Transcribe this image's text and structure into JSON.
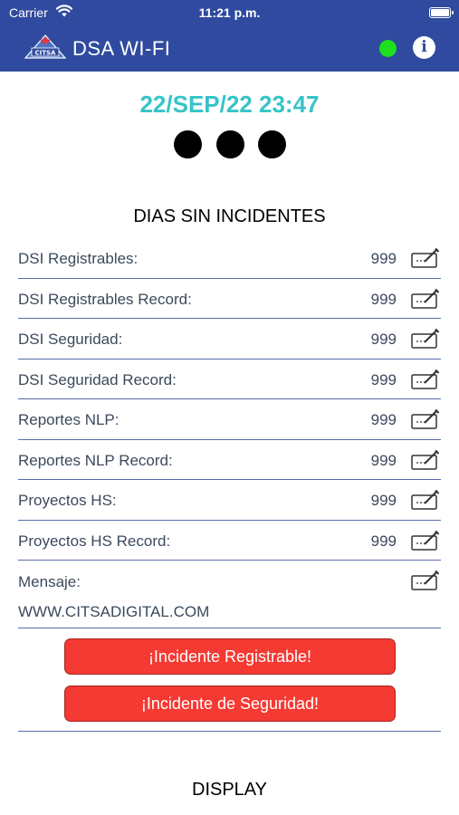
{
  "status_bar": {
    "carrier": "Carrier",
    "time": "11:21 p.m."
  },
  "header": {
    "title": "DSA WI-FI",
    "logo_text": "CITSA",
    "info_label": "i",
    "connection_color": "#1ee01e",
    "bar_color": "#2f4a9e"
  },
  "datetime": "22/SEP/22 23:47",
  "section_title": "DIAS SIN INCIDENTES",
  "counters": [
    {
      "label": "DSI Registrables:",
      "value": "999"
    },
    {
      "label": "DSI Registrables Record:",
      "value": "999"
    },
    {
      "label": "DSI Seguridad:",
      "value": "999"
    },
    {
      "label": "DSI Seguridad Record:",
      "value": "999"
    },
    {
      "label": "Reportes NLP:",
      "value": "999"
    },
    {
      "label": "Reportes NLP Record:",
      "value": "999"
    },
    {
      "label": "Proyectos HS:",
      "value": "999"
    },
    {
      "label": "Proyectos HS Record:",
      "value": "999"
    }
  ],
  "message": {
    "label": "Mensaje:",
    "value": "WWW.CITSADIGITAL.COM"
  },
  "buttons": {
    "registrable": "¡Incidente Registrable!",
    "seguridad": "¡Incidente de Seguridad!",
    "display": "DISPLAY",
    "color": "#f43a33"
  }
}
